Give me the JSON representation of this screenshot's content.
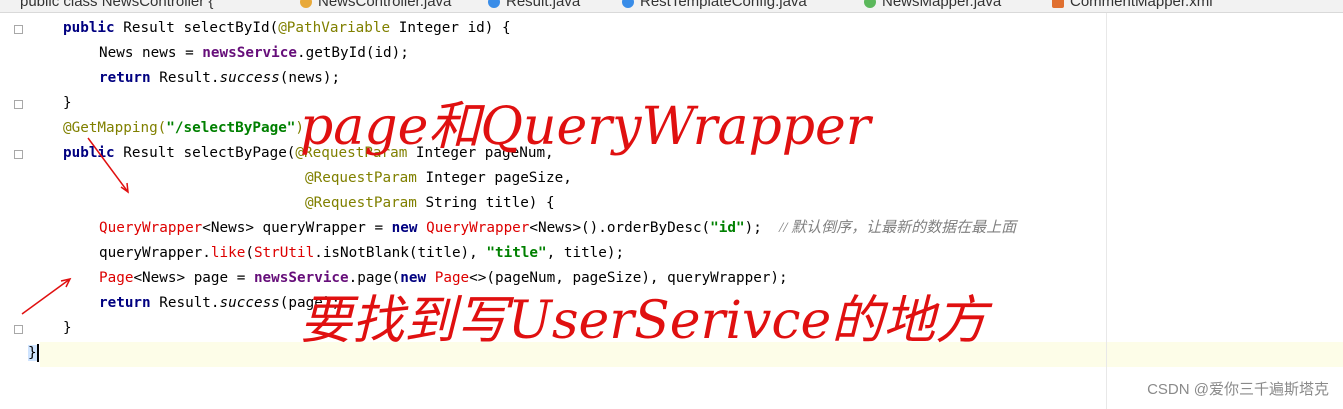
{
  "tabs": [
    {
      "label": "public class NewsController {",
      "color": "#1e90ff"
    },
    {
      "label": "NewsController.java",
      "color": "#e8a93a"
    },
    {
      "label": "Result.java",
      "color": "#3a8de8"
    },
    {
      "label": "RestTemplateConfig.java",
      "color": "#3a8de8"
    },
    {
      "label": "NewsMapper.java",
      "color": "#5cb85c"
    },
    {
      "label": "CommentMapper.xml",
      "color": "#e07030"
    }
  ],
  "code": {
    "l1_kw": "public",
    "l1_rest": " Result selectById(",
    "l1_ann": "@PathVariable",
    "l1_tail": " Integer id) {",
    "l2_a": "News news = ",
    "l2_field": "newsService",
    "l2_b": ".getById(id);",
    "l3_kw": "return",
    "l3_a": " Result.",
    "l3_it": "success",
    "l3_b": "(news);",
    "l4": "}",
    "l5_ann": "@GetMapping(",
    "l5_str": "\"/selectByPage\"",
    "l5_tail": ")",
    "l6_kw": "public",
    "l6_rest": " Result selectByPage(",
    "l6_ann": "@RequestParam",
    "l6_tail": " Integer pageNum,",
    "l7_ann": "@RequestParam",
    "l7_tail": " Integer pageSize,",
    "l8_ann": "@RequestParam",
    "l8_tail": " String title) {",
    "l9_cls": "QueryWrapper",
    "l9_a": "<News> queryWrapper = ",
    "l9_kw": "new",
    "l9_cls2": " QueryWrapper",
    "l9_b": "<News>().orderByDesc(",
    "l9_str": "\"id\"",
    "l9_c": ");  ",
    "l9_cmt": "// 默认倒序，让最新的数据在最上面",
    "l10_a": "queryWrapper.",
    "l10_like": "like",
    "l10_b": "(",
    "l10_cls": "StrUtil",
    "l10_c": ".isNotBlank(title), ",
    "l10_str": "\"title\"",
    "l10_d": ", title);",
    "l11_cls": "Page",
    "l11_a": "<News> page = ",
    "l11_field": "newsService",
    "l11_b": ".page(",
    "l11_kw": "new",
    "l11_cls2": " Page",
    "l11_c": "<>(pageNum, pageSize), queryWrapper);",
    "l12_kw": "return",
    "l12_a": " Result.",
    "l12_it": "success",
    "l12_b": "(page);",
    "l13": "}",
    "l14": "}"
  },
  "annotations": {
    "note1": "page和QueryWrapper",
    "note2": "要找到写UserSerivce的地方",
    "color": "#e01010"
  },
  "watermark": "CSDN @爱你三千遍斯塔克"
}
